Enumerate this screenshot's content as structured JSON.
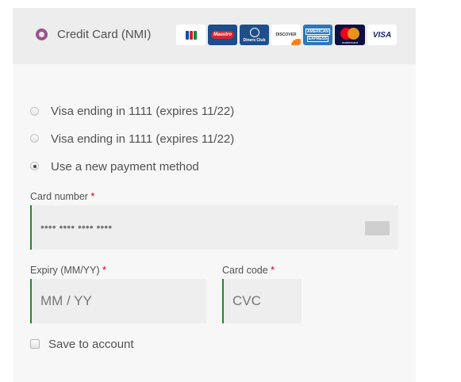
{
  "payment_method": {
    "label": "Credit Card (NMI)",
    "card_logos": [
      "jcb-icon",
      "maestro-icon",
      "diners-club-icon",
      "discover-icon",
      "american-express-icon",
      "mastercard-icon",
      "visa-icon"
    ],
    "logo_text": {
      "maestro": "Maestro",
      "diners": "Diners Club",
      "discover": "DISCOVER",
      "amex_top": "AMERICAN",
      "amex_bottom": "EXPRESS",
      "mastercard": "mastercard",
      "visa": "VISA"
    }
  },
  "saved_methods": [
    {
      "label": "Visa ending in 1111 (expires 11/22)",
      "selected": false
    },
    {
      "label": "Visa ending in 1111 (expires 11/22)",
      "selected": false
    },
    {
      "label": "Use a new payment method",
      "selected": true
    }
  ],
  "card_number": {
    "label": "Card number",
    "required_marker": "*",
    "value": "•••• •••• •••• ••••"
  },
  "expiry": {
    "label": "Expiry (MM/YY)",
    "required_marker": "*",
    "placeholder": "MM / YY"
  },
  "card_code": {
    "label": "Card code",
    "required_marker": "*",
    "placeholder": "CVC"
  },
  "save_to_account": {
    "label": "Save to account",
    "checked": false
  },
  "colors": {
    "accent": "#96588a",
    "input_border": "#2f7d3b",
    "required": "#cc0000"
  }
}
